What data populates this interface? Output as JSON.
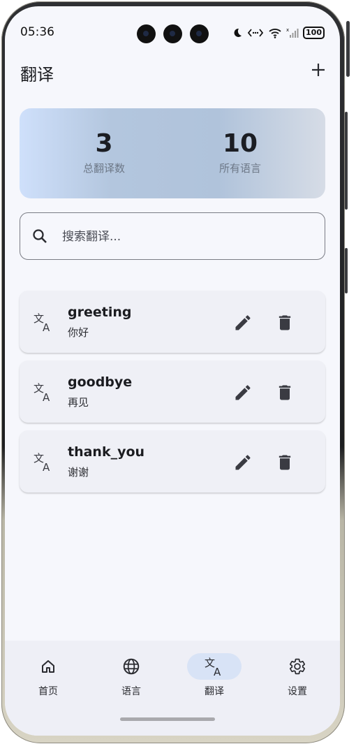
{
  "status_bar": {
    "time": "05:36",
    "battery": "100"
  },
  "header": {
    "title": "翻译"
  },
  "stats": [
    {
      "value": "3",
      "label": "总翻译数"
    },
    {
      "value": "10",
      "label": "所有语言"
    }
  ],
  "search": {
    "placeholder": "搜索翻译..."
  },
  "translations": [
    {
      "key": "greeting",
      "value": "你好"
    },
    {
      "key": "goodbye",
      "value": "再见"
    },
    {
      "key": "thank_you",
      "value": "谢谢"
    }
  ],
  "nav": {
    "items": [
      {
        "label": "首页",
        "icon": "home-icon"
      },
      {
        "label": "语言",
        "icon": "globe-icon"
      },
      {
        "label": "翻译",
        "icon": "translate-icon",
        "active": true
      },
      {
        "label": "设置",
        "icon": "gear-icon"
      }
    ]
  },
  "colors": {
    "accent_pill": "#d8e3f6",
    "background": "#f6f7fc"
  }
}
